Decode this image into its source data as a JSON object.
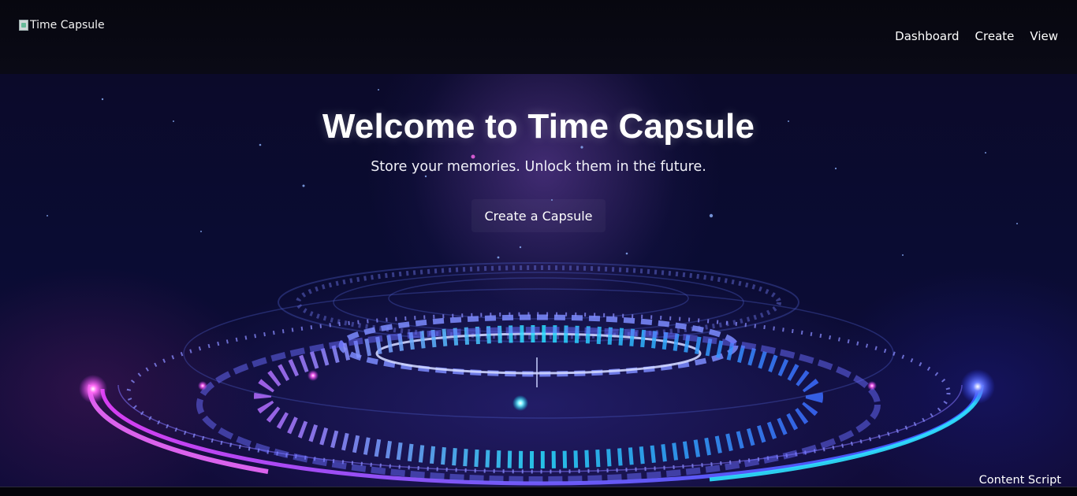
{
  "header": {
    "logo_alt": "Time Capsule",
    "nav": [
      {
        "label": "Dashboard"
      },
      {
        "label": "Create"
      },
      {
        "label": "View"
      }
    ]
  },
  "hero": {
    "title": "Welcome to Time Capsule",
    "subtitle": "Store your memories. Unlock them in the future.",
    "cta_label": "Create a Capsule"
  },
  "footer": {
    "content_script": "Content Script"
  },
  "colors": {
    "background": "#0a0c33",
    "glow_pink": "#e040fb",
    "glow_blue": "#3a5bff",
    "glow_cyan": "#00e5ff"
  }
}
